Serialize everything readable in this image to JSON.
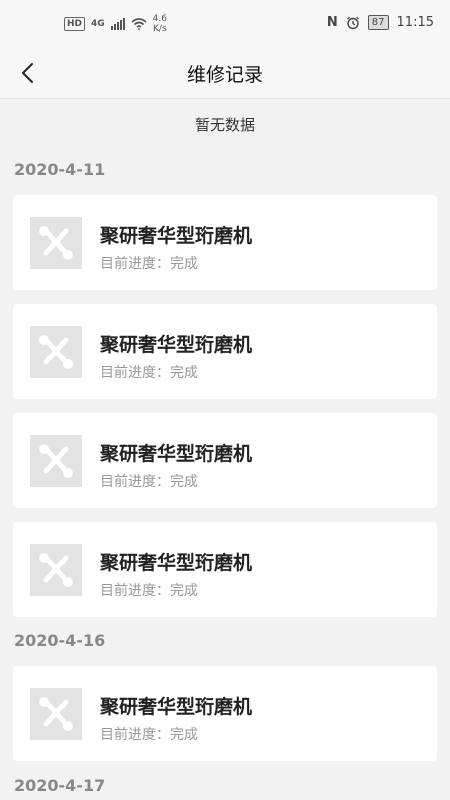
{
  "status_bar": {
    "hd": "HD",
    "network": "4G",
    "speed_value": "4.6",
    "speed_unit": "K/s",
    "battery": "87",
    "time": "11:15"
  },
  "header": {
    "title": "维修记录",
    "back_icon": "chevron-left-icon"
  },
  "empty_text": "暂无数据",
  "groups": [
    {
      "date": "2020-4-11"
    },
    {
      "date": "2020-4-16"
    },
    {
      "date": "2020-4-17"
    }
  ],
  "records": [
    {
      "title": "聚研奢华型珩磨机",
      "status": "目前进度：完成",
      "icon": "repair-tools-icon"
    },
    {
      "title": "聚研奢华型珩磨机",
      "status": "目前进度：完成",
      "icon": "repair-tools-icon"
    },
    {
      "title": "聚研奢华型珩磨机",
      "status": "目前进度：完成",
      "icon": "repair-tools-icon"
    },
    {
      "title": "聚研奢华型珩磨机",
      "status": "目前进度：完成",
      "icon": "repair-tools-icon"
    },
    {
      "title": "聚研奢华型珩磨机",
      "status": "目前进度：完成",
      "icon": "repair-tools-icon"
    }
  ],
  "colors": {
    "background": "#f2f2f2",
    "card": "#ffffff",
    "date_text": "#888888",
    "icon_bg": "#e3e3e3"
  }
}
